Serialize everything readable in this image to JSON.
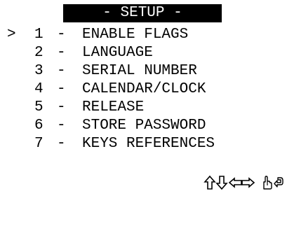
{
  "screen": {
    "title": " - SETUP - "
  },
  "menu": {
    "cursor_symbol": ">",
    "items": [
      {
        "number": "1",
        "separator": "-",
        "label": "ENABLE FLAGS",
        "selected": true
      },
      {
        "number": "2",
        "separator": "-",
        "label": "LANGUAGE",
        "selected": false
      },
      {
        "number": "3",
        "separator": "-",
        "label": "SERIAL NUMBER",
        "selected": false
      },
      {
        "number": "4",
        "separator": "-",
        "label": "CALENDAR/CLOCK",
        "selected": false
      },
      {
        "number": "5",
        "separator": "-",
        "label": "RELEASE",
        "selected": false
      },
      {
        "number": "6",
        "separator": "-",
        "label": "STORE PASSWORD",
        "selected": false
      },
      {
        "number": "7",
        "separator": "-",
        "label": "KEYS REFERENCES",
        "selected": false
      }
    ]
  },
  "key_hints": {
    "icons": [
      "arrow-up-icon",
      "arrow-down-icon",
      "arrow-left-icon",
      "arrow-right-icon",
      "hand-icon",
      "return-icon"
    ]
  },
  "colors": {
    "background": "#ffffff",
    "foreground": "#000000",
    "title_background": "#000000",
    "title_text": "#ffffff"
  }
}
